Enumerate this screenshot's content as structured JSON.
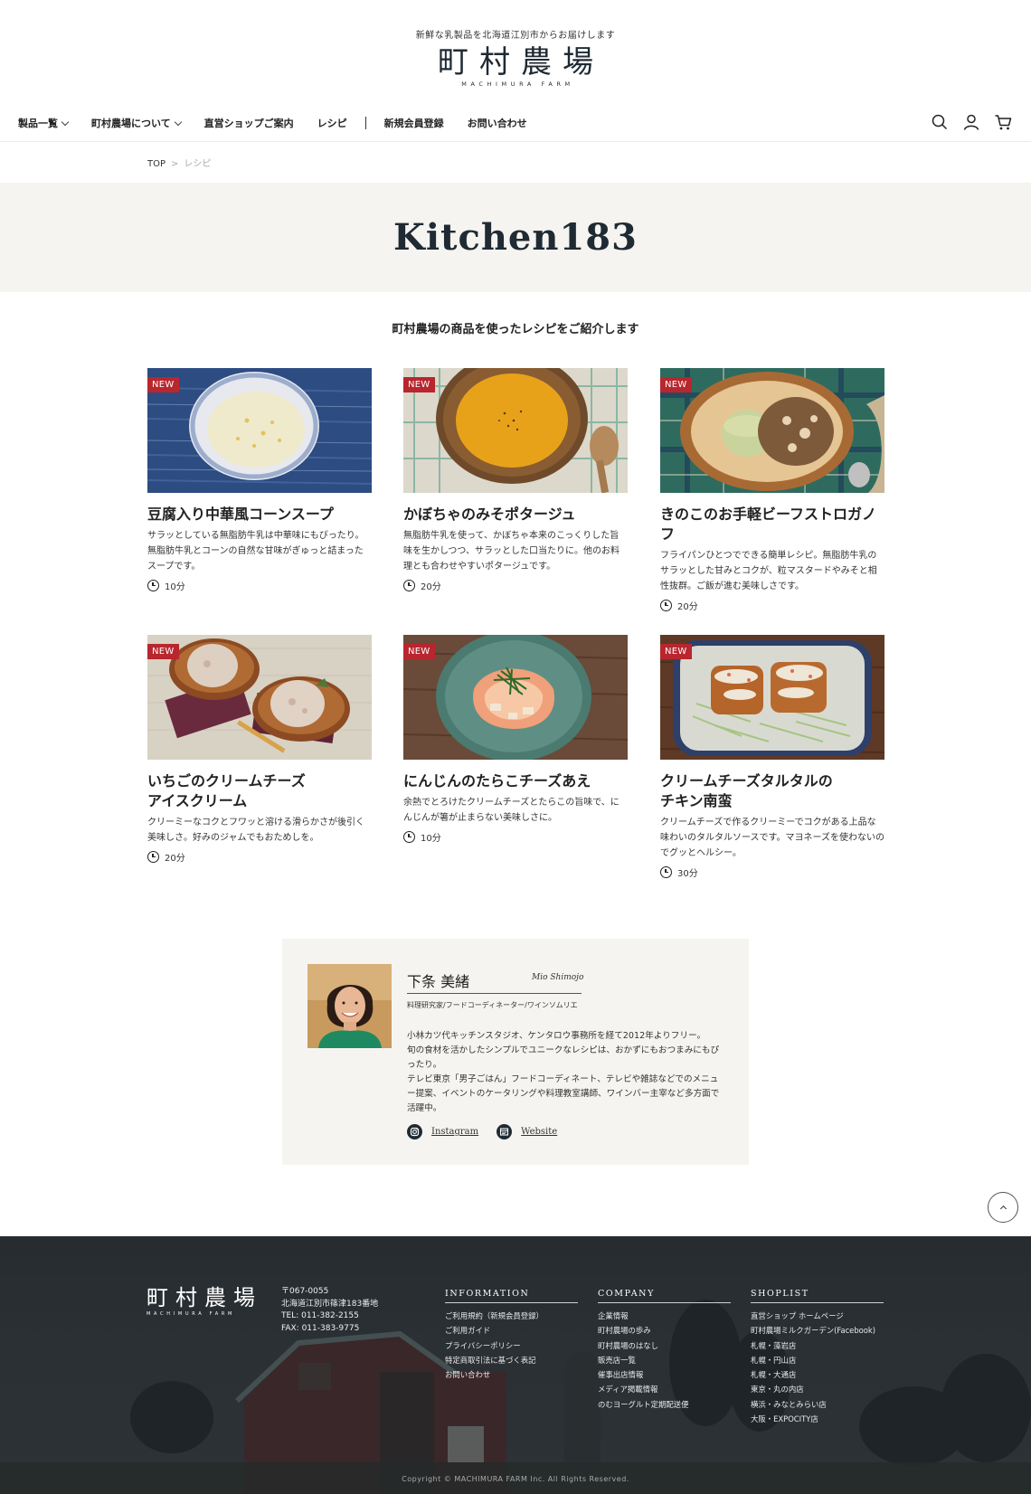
{
  "header": {
    "tagline": "新鮮な乳製品を北海道江別市からお届けします",
    "logo_jp": "町村農場",
    "logo_en": "MACHIMURA FARM",
    "nav": [
      {
        "label": "製品一覧",
        "has_dropdown": true
      },
      {
        "label": "町村農場について",
        "has_dropdown": true
      },
      {
        "label": "直営ショップご案内",
        "has_dropdown": false
      },
      {
        "label": "レシピ",
        "has_dropdown": false
      },
      {
        "label": "新規会員登録",
        "has_dropdown": false
      },
      {
        "label": "お問い合わせ",
        "has_dropdown": false
      }
    ],
    "icons": [
      "search-icon",
      "user-icon",
      "cart-icon"
    ]
  },
  "breadcrumb": {
    "home": "TOP",
    "separator": ">",
    "current": "レシピ"
  },
  "hero": {
    "title": "Kitchen183"
  },
  "intro": "町村農場の商品を使ったレシピをご紹介します",
  "badge_label": "NEW",
  "recipes": [
    {
      "title": "豆腐入り中華風コーンスープ",
      "desc": "サラッとしている無脂肪牛乳は中華味にもぴったり。無脂肪牛乳とコーンの自然な甘味がぎゅっと詰まったスープです。",
      "time": "10分",
      "image": "corn-soup-photo"
    },
    {
      "title": "かぼちゃのみそポタージュ",
      "desc": "無脂肪牛乳を使って、かぼちゃ本来のこっくりした旨味を生かしつつ、サラッとした口当たりに。他のお料理とも合わせやすいポタージュです。",
      "time": "20分",
      "image": "pumpkin-potage-photo"
    },
    {
      "title": "きのこのお手軽ビーフストロガノフ",
      "desc": "フライパンひとつでできる簡単レシピ。無脂肪牛乳のサラッとした甘みとコクが、粒マスタードやみそと相性抜群。ご飯が進む美味しさです。",
      "time": "20分",
      "image": "beef-stroganoff-photo"
    },
    {
      "title": "いちごのクリームチーズ\nアイスクリーム",
      "desc": "クリーミーなコクとフワッと溶ける滑らかさが後引く美味しさ。好みのジャムでもおためしを。",
      "time": "20分",
      "image": "strawberry-ice-cream-photo"
    },
    {
      "title": "にんじんのたらこチーズあえ",
      "desc": "余熱でとろけたクリームチーズとたらこの旨味で、にんじんが箸が止まらない美味しさに。",
      "time": "10分",
      "image": "carrot-tarako-photo"
    },
    {
      "title": "クリームチーズタルタルの\nチキン南蛮",
      "desc": "クリームチーズで作るクリーミーでコクがある上品な味わいのタルタルソースです。マヨネーズを使わないのでグッとヘルシー。",
      "time": "30分",
      "image": "chicken-nanban-photo"
    }
  ],
  "profile": {
    "name": "下条 美緒",
    "roman": "Mio Shimojo",
    "role": "料理研究家/フードコーディネーター/ワインソムリエ",
    "bio": [
      "小林カツ代キッチンスタジオ、ケンタロウ事務所を経て2012年よりフリー。",
      "旬の食材を活かしたシンプルでユニークなレシピは、おかずにもおつまみにもぴったり。",
      "テレビ東京「男子ごはん」フードコーディネート、テレビや雑誌などでのメニュー提案、イベントのケータリングや料理教室講師、ワインバー主宰など多方面で活躍中。"
    ],
    "links": [
      {
        "label": "Instagram",
        "icon": "instagram-icon"
      },
      {
        "label": "Website",
        "icon": "website-icon"
      }
    ]
  },
  "footer": {
    "logo_jp": "町村農場",
    "logo_en": "MACHIMURA FARM",
    "address": [
      "〒067-0055",
      "北海道江別市篠津183番地",
      "TEL: 011-382-2155",
      "FAX: 011-383-9775"
    ],
    "columns": [
      {
        "heading": "INFORMATION",
        "items": [
          "ご利用規約（新規会員登録）",
          "ご利用ガイド",
          "プライバシーポリシー",
          "特定商取引法に基づく表記",
          "お問い合わせ"
        ]
      },
      {
        "heading": "COMPANY",
        "items": [
          "企業情報",
          "町村農場の歩み",
          "町村農場のはなし",
          "販売店一覧",
          "催事出店情報",
          "メディア掲載情報",
          "のむヨーグルト定期配送便"
        ]
      },
      {
        "heading": "SHOPLIST",
        "items": [
          "直営ショップ ホームページ",
          "町村農場ミルクガーデン(Facebook)",
          "札幌・藻岩店",
          "札幌・円山店",
          "札幌・大通店",
          "東京・丸の内店",
          "横浜・みなとみらい店",
          "大阪・EXPOCITY店"
        ]
      }
    ],
    "copyright": "Copyright © MACHIMURA FARM Inc. All Rights Reserved."
  }
}
